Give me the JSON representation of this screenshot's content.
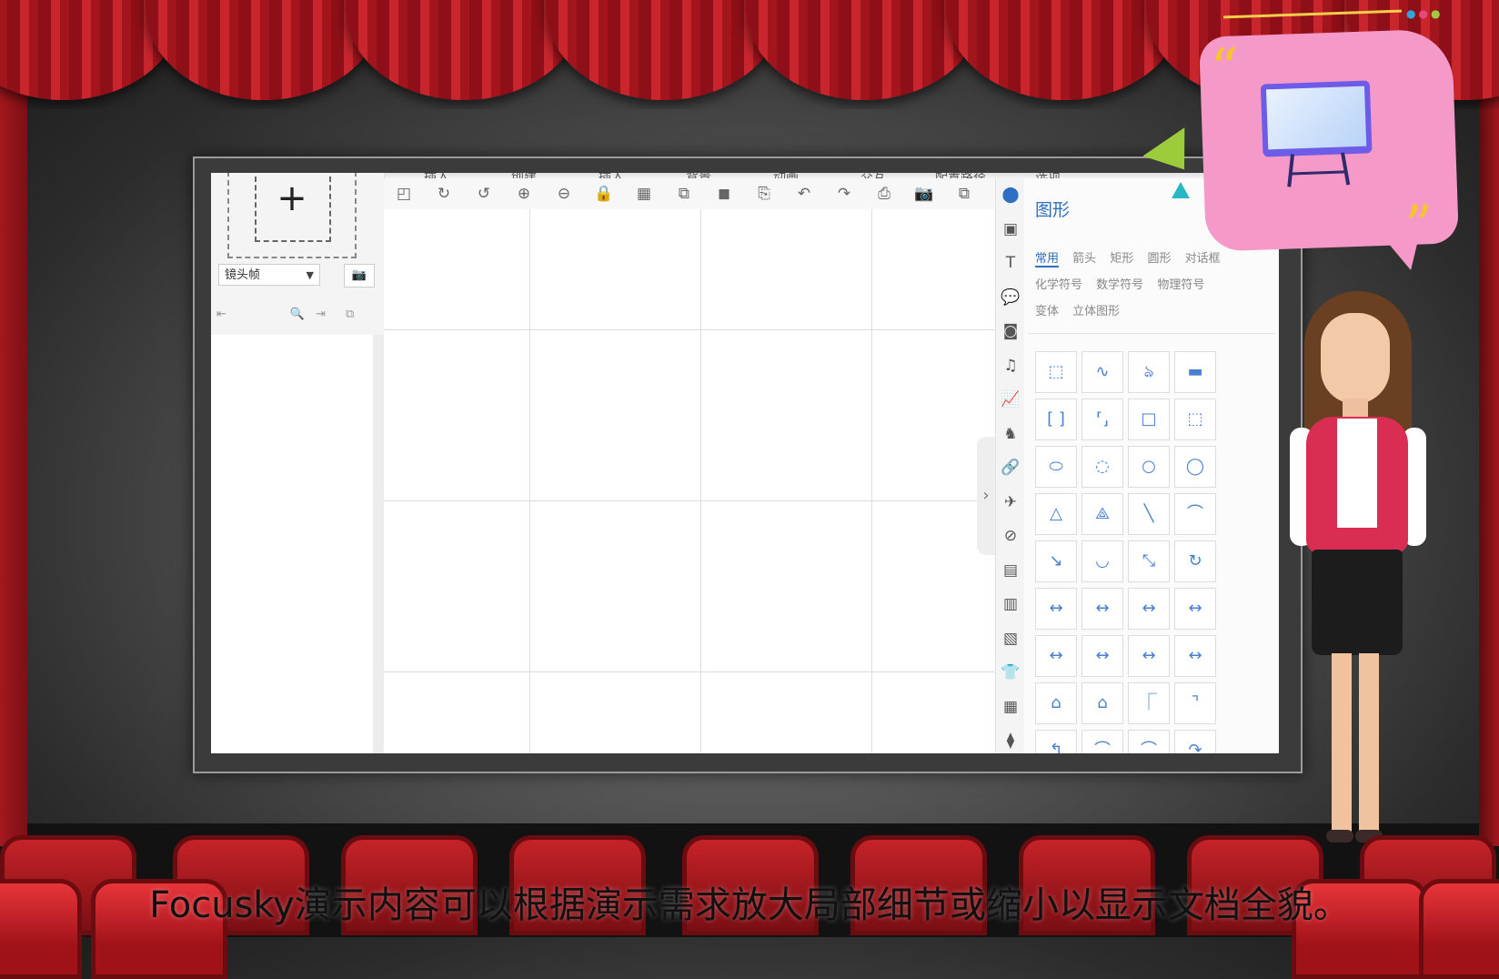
{
  "editor": {
    "menu": [
      "插入",
      "创建",
      "插入",
      "背景",
      "动画",
      "交互",
      "配置路径",
      "选项"
    ],
    "left_panel": {
      "add_frame_symbol": "+",
      "frame_type_value": "镜头帧",
      "frame_type_arrow": "▼",
      "camera_symbol": "📷",
      "bar_icons": [
        "⇤",
        "🔍",
        "⇥",
        "⧉"
      ]
    },
    "toolbar_icons": [
      "◰",
      "↻",
      "↺",
      "⊕",
      "⊖",
      "🔒",
      "▦",
      "⧉",
      "◼",
      "⎘",
      "↶",
      "↷",
      "⎙",
      "📷",
      "⧉"
    ],
    "icon_column": [
      "⬤",
      "▣",
      "T",
      "💬",
      "◙",
      "♫",
      "📈",
      "♞",
      "🔗",
      "✈",
      "⊘",
      "▤",
      "▥",
      "▧",
      "👕",
      "▦",
      "⧫"
    ],
    "shape_panel": {
      "title": "图形",
      "tabs_row1": [
        "常用",
        "箭头",
        "矩形",
        "圆形",
        "对话框"
      ],
      "tabs_row2": [
        "化学符号",
        "数学符号",
        "物理符号"
      ],
      "tabs_row3": [
        "变体",
        "立体图形"
      ],
      "shapes": [
        "⬚",
        "∿",
        "ঌ",
        "▬",
        "[ ]",
        "⸢⸥",
        "□",
        "⬚",
        "⬭",
        "◌",
        "○",
        "◯",
        "△",
        "⟁",
        "╲",
        "⌒",
        "↘",
        "◡",
        "⤡",
        "↻",
        "↔",
        "↔",
        "↔",
        "↔",
        "↔",
        "↔",
        "↔",
        "↔",
        "⌂",
        "⌂",
        "⎾",
        "⌝",
        "↰",
        "⌒",
        "⌒",
        "↷"
      ]
    },
    "collapse_symbol": "›"
  },
  "bubble": {
    "quote_open": "“",
    "quote_close": "”"
  },
  "caption": "Focusky演示内容可以根据演示需求放大局部细节或缩小以显示文档全貌。"
}
